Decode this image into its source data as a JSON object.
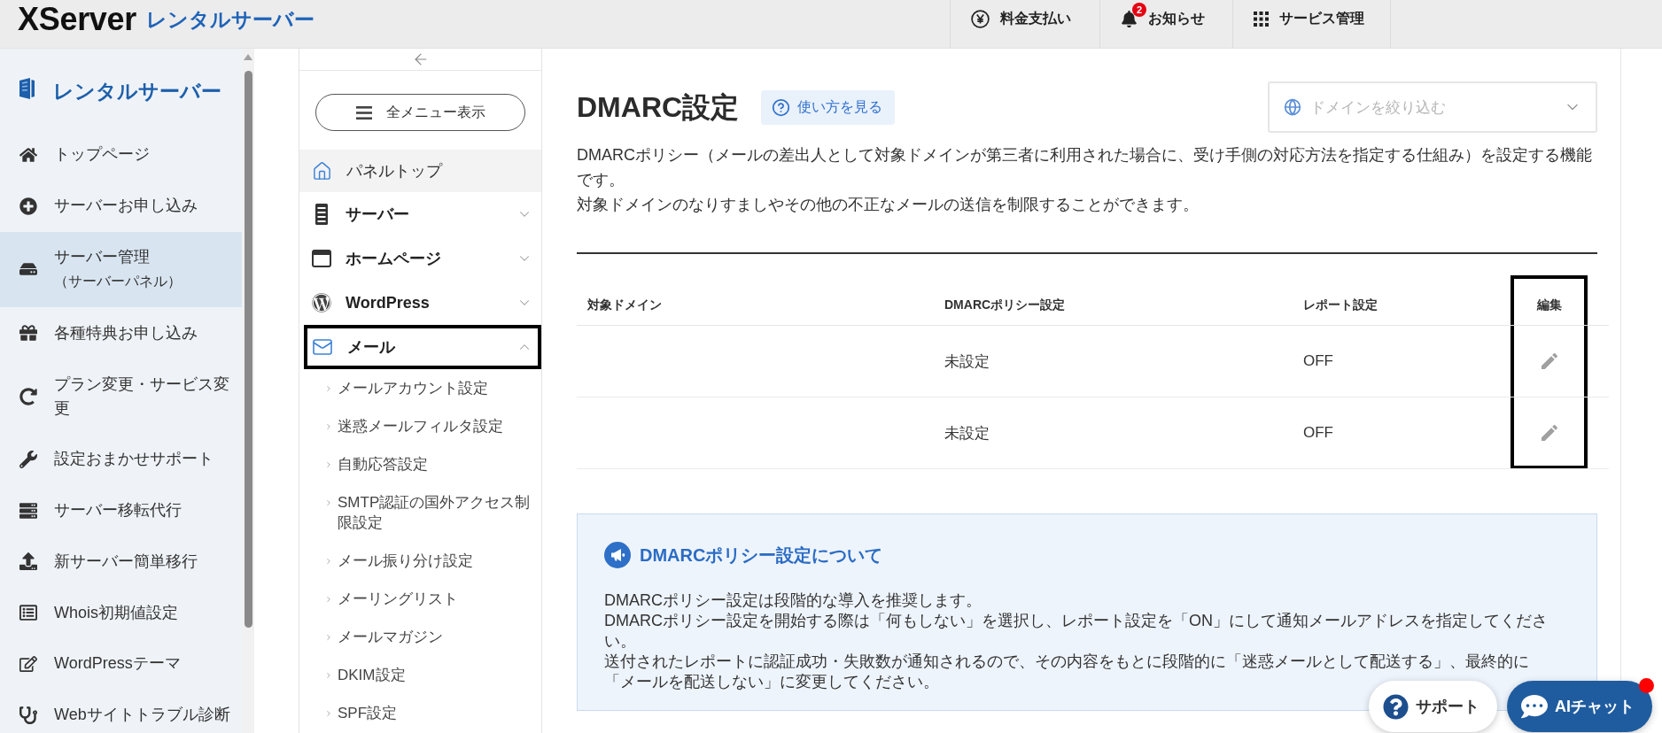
{
  "header": {
    "logo": {
      "brand": "XServer",
      "product": "レンタルサーバー"
    },
    "actions": [
      {
        "kind": "payment",
        "label": "料金支払い"
      },
      {
        "kind": "notice",
        "label": "お知らせ",
        "badge": "2"
      },
      {
        "kind": "services",
        "label": "サービス管理"
      }
    ]
  },
  "sidebar": {
    "title": "レンタルサーバー",
    "items": [
      {
        "label": "トップページ",
        "selected": false
      },
      {
        "label": "サーバーお申し込み",
        "selected": false
      },
      {
        "label": "サーバー管理",
        "sublabel": "（サーバーパネル）",
        "selected": true
      },
      {
        "label": "各種特典お申し込み",
        "selected": false
      },
      {
        "label": "プラン変更・サービス変更",
        "selected": false
      },
      {
        "label": "設定おまかせサポート",
        "selected": false
      },
      {
        "label": "サーバー移転代行",
        "selected": false
      },
      {
        "label": "新サーバー簡単移行",
        "selected": false
      },
      {
        "label": "Whois初期値設定",
        "selected": false
      },
      {
        "label": "WordPressテーマ",
        "selected": false
      },
      {
        "label": "Webサイトトラブル診断",
        "selected": false
      }
    ]
  },
  "panel_menu": {
    "all_menu_button": "全メニュー表示",
    "top_link": "パネルトップ",
    "sections": [
      {
        "label": "サーバー",
        "expanded": false,
        "annotated": false
      },
      {
        "label": "ホームページ",
        "expanded": false,
        "annotated": false
      },
      {
        "label": "WordPress",
        "expanded": false,
        "annotated": false
      },
      {
        "label": "メール",
        "expanded": true,
        "annotated": true,
        "children": [
          {
            "label": "メールアカウント設定"
          },
          {
            "label": "迷惑メールフィルタ設定"
          },
          {
            "label": "自動応答設定"
          },
          {
            "label": "SMTP認証の国外アクセス制限設定"
          },
          {
            "label": "メール振り分け設定"
          },
          {
            "label": "メーリングリスト"
          },
          {
            "label": "メールマガジン"
          },
          {
            "label": "DKIM設定"
          },
          {
            "label": "SPF設定"
          }
        ]
      }
    ]
  },
  "page": {
    "title": "DMARC設定",
    "help_button": "使い方を見る",
    "domain_filter": {
      "placeholder": "ドメインを絞り込む"
    },
    "description": [
      "DMARCポリシー（メールの差出人として対象ドメインが第三者に利用された場合に、受け手側の対応方法を指定する仕組み）を設定する機能です。",
      "対象ドメインのなりすましやその他の不正なメールの送信を制限することができます。"
    ]
  },
  "table": {
    "columns": [
      {
        "label": "対象ドメイン",
        "annotated": false
      },
      {
        "label": "DMARCポリシー設定",
        "annotated": false
      },
      {
        "label": "レポート設定",
        "annotated": false
      },
      {
        "label": "編集",
        "annotated": true
      }
    ],
    "rows": [
      {
        "dmarc_policy": "未設定",
        "report": "OFF"
      },
      {
        "dmarc_policy": "未設定",
        "report": "OFF"
      }
    ]
  },
  "info_box": {
    "title": "DMARCポリシー設定について",
    "paragraphs": [
      "DMARCポリシー設定は段階的な導入を推奨します。",
      "DMARCポリシー設定を開始する際は「何もしない」を選択し、レポート設定を「ON」にして通知メールアドレスを指定してください。",
      "送付されたレポートに認証成功・失敗数が通知されるので、その内容をもとに段階的に「迷惑メールとして配送する」、最終的に「メールを配送しない」に変更してください。"
    ]
  },
  "floating_buttons": [
    {
      "kind": "support",
      "label": "サポート",
      "notification": false
    },
    {
      "kind": "chat",
      "label": "AIチャット",
      "notification": true
    }
  ]
}
